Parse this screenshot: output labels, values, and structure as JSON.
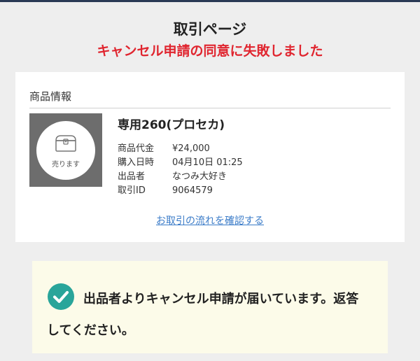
{
  "header": {
    "title": "取引ページ",
    "error_message": "キャンセル申請の同意に失敗しました"
  },
  "product": {
    "section_title": "商品情報",
    "thumbnail": {
      "icon": "treasure-chest-icon",
      "label": "売ります"
    },
    "name": "専用260(プロセカ)",
    "details": [
      {
        "label": "商品代金",
        "value": "¥24,000"
      },
      {
        "label": "購入日時",
        "value": "04月10日 01:25"
      },
      {
        "label": "出品者",
        "value": "なつみ大好き"
      },
      {
        "label": "取引ID",
        "value": "9064579"
      }
    ],
    "flow_link": "お取引の流れを確認する"
  },
  "notice": {
    "icon": "check-circle-icon",
    "text": "出品者よりキャンセル申請が届いています。返答してください。"
  },
  "colors": {
    "error": "#e0252f",
    "link": "#3a7bc8",
    "check": "#29a59a",
    "notice_bg": "#fcfbe9",
    "top_bar": "#2a3a55"
  }
}
